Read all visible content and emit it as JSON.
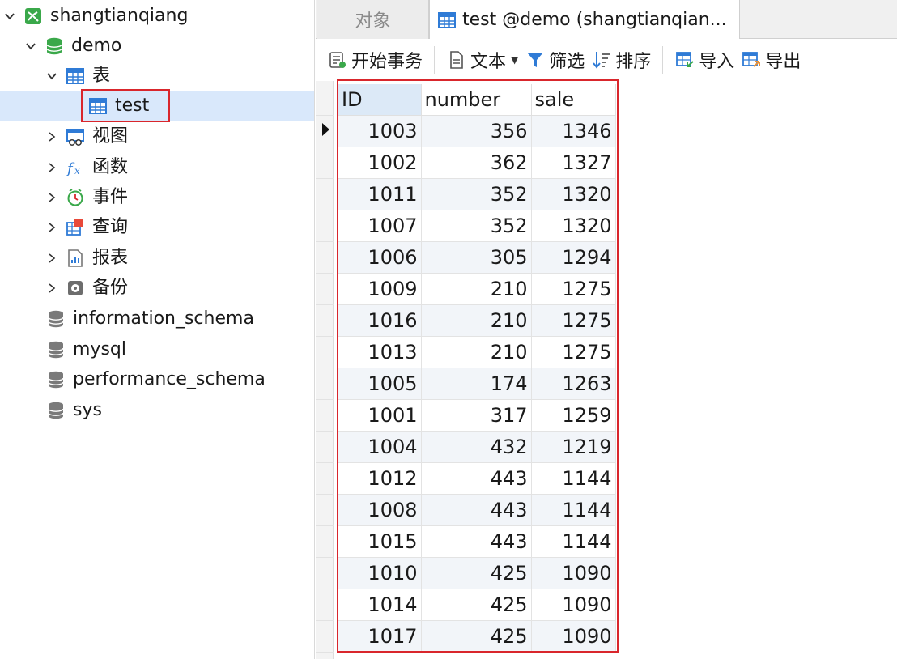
{
  "tree": {
    "connection": "shangtianqiang",
    "database": "demo",
    "tables_group": "表",
    "table_item": "test",
    "views": "视图",
    "functions": "函数",
    "events": "事件",
    "queries": "查询",
    "reports": "报表",
    "backups": "备份",
    "other_dbs": [
      "information_schema",
      "mysql",
      "performance_schema",
      "sys"
    ]
  },
  "tabs": {
    "objects": "对象",
    "active": "test @demo (shangtianqian..."
  },
  "toolbar": {
    "begin_transaction": "开始事务",
    "text": "文本",
    "filter": "筛选",
    "sort": "排序",
    "import": "导入",
    "export": "导出"
  },
  "table": {
    "columns": [
      "ID",
      "number",
      "sale"
    ],
    "rows": [
      [
        "1003",
        "356",
        "1346"
      ],
      [
        "1002",
        "362",
        "1327"
      ],
      [
        "1011",
        "352",
        "1320"
      ],
      [
        "1007",
        "352",
        "1320"
      ],
      [
        "1006",
        "305",
        "1294"
      ],
      [
        "1009",
        "210",
        "1275"
      ],
      [
        "1016",
        "210",
        "1275"
      ],
      [
        "1013",
        "210",
        "1275"
      ],
      [
        "1005",
        "174",
        "1263"
      ],
      [
        "1001",
        "317",
        "1259"
      ],
      [
        "1004",
        "432",
        "1219"
      ],
      [
        "1012",
        "443",
        "1144"
      ],
      [
        "1008",
        "443",
        "1144"
      ],
      [
        "1015",
        "443",
        "1144"
      ],
      [
        "1010",
        "425",
        "1090"
      ],
      [
        "1014",
        "425",
        "1090"
      ],
      [
        "1017",
        "425",
        "1090"
      ]
    ]
  },
  "colors": {
    "highlight_border": "#d9262c",
    "selected_row": "#d9e8fb",
    "db_icon": "#3aa84a",
    "table_icon": "#2f7bd6"
  }
}
